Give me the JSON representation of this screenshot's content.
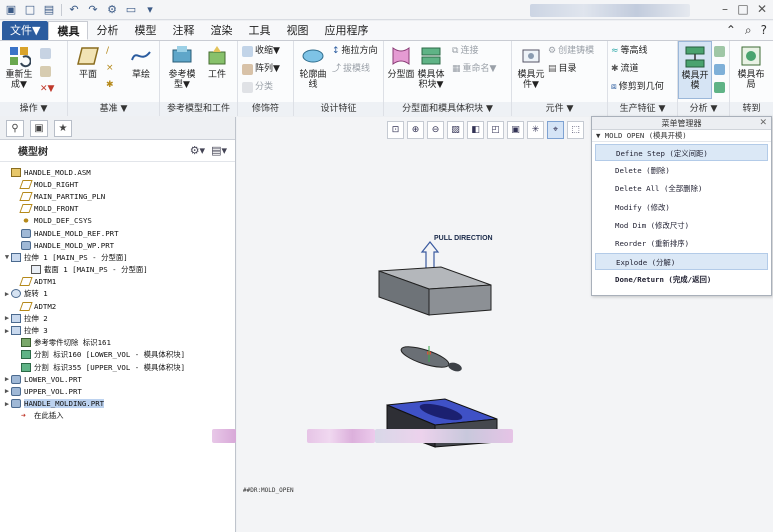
{
  "titlebar": {
    "quick_access_icons": [
      "new-icon",
      "open-icon",
      "save-icon",
      "undo-icon",
      "redo-icon",
      "regenerate-icon",
      "windows-icon",
      "close-icon"
    ],
    "window_controls": [
      "minimize",
      "maximize",
      "close"
    ]
  },
  "menu": {
    "tabs": [
      "文件▼",
      "模具",
      "分析",
      "模型",
      "注释",
      "渲染",
      "工具",
      "视图",
      "应用程序"
    ],
    "active_tab": "模具",
    "right_icons": [
      "ribbon-toggle-icon",
      "search-icon",
      "help-icon"
    ]
  },
  "ribbon": {
    "groups": [
      {
        "label": "操作 ▼",
        "big": [
          "重新生成▼"
        ],
        "small": [
          "✕▼"
        ]
      },
      {
        "label": "基准 ▼",
        "big": [
          "平面",
          "草绘"
        ],
        "small": []
      },
      {
        "label": "参考模型和工件",
        "big": [
          "参考模型▼",
          "工件"
        ],
        "small": []
      },
      {
        "label": "修饰符",
        "big": [],
        "small": [
          "收缩▼",
          "阵列▼",
          "分类"
        ]
      },
      {
        "label": "设计特征",
        "big": [
          "轮廓曲线"
        ],
        "small": [
          "拖拉方向",
          "拔模线"
        ]
      },
      {
        "label": "分型面和模具体积块 ▼",
        "big": [
          "分型面",
          "模具体积块▼"
        ],
        "small": [
          "连接",
          "重命名▼"
        ]
      },
      {
        "label": "元件 ▼",
        "big": [
          "模具元件▼"
        ],
        "small": [
          "创建铸模",
          "目录"
        ]
      },
      {
        "label": "生产特征 ▼",
        "big": [],
        "small": [
          "等高线",
          "流道",
          "修剪到几何"
        ]
      },
      {
        "label": "分析 ▼",
        "big": [
          "模具开模"
        ],
        "small": []
      },
      {
        "label": "转到",
        "big": [
          "模具布局"
        ],
        "small": []
      }
    ]
  },
  "left_panel": {
    "heading": "模型树",
    "tree": [
      {
        "label": "HANDLE_MOLD.ASM",
        "icon": "assembly-icon",
        "expander": "",
        "indent": 0
      },
      {
        "label": "MOLD_RIGHT",
        "icon": "datum-plane-icon",
        "expander": "",
        "indent": 1
      },
      {
        "label": "MAIN_PARTING_PLN",
        "icon": "datum-plane-icon",
        "expander": "",
        "indent": 1
      },
      {
        "label": "MOLD_FRONT",
        "icon": "datum-plane-icon",
        "expander": "",
        "indent": 1
      },
      {
        "label": "MOLD_DEF_CSYS",
        "icon": "csys-icon",
        "expander": "",
        "indent": 1
      },
      {
        "label": "HANDLE_MOLD_REF.PRT",
        "icon": "part-icon",
        "expander": "",
        "indent": 1
      },
      {
        "label": "HANDLE_MOLD_WP.PRT",
        "icon": "part-icon",
        "expander": "",
        "indent": 1
      },
      {
        "label": "拉伸 1 [MAIN_PS - 分型面]",
        "icon": "extrude-icon",
        "expander": "▼",
        "indent": 0
      },
      {
        "label": "截面 1 [MAIN_PS - 分型面]",
        "icon": "sketch-icon",
        "expander": "",
        "indent": 2
      },
      {
        "label": "ADTM1",
        "icon": "datum-plane-icon",
        "expander": "",
        "indent": 1
      },
      {
        "label": "旋转 1",
        "icon": "revolve-icon",
        "expander": "▶",
        "indent": 0
      },
      {
        "label": "ADTM2",
        "icon": "datum-plane-icon",
        "expander": "",
        "indent": 1
      },
      {
        "label": "拉伸 2",
        "icon": "extrude-icon",
        "expander": "▶",
        "indent": 0
      },
      {
        "label": "拉伸 3",
        "icon": "extrude-icon",
        "expander": "▶",
        "indent": 0
      },
      {
        "label": "参考零件切除 标识161",
        "icon": "cut-icon",
        "expander": "",
        "indent": 1
      },
      {
        "label": "分割 标识160 [LOWER_VOL - 模具体积块]",
        "icon": "split-icon",
        "expander": "",
        "indent": 1
      },
      {
        "label": "分割 标识355 [UPPER_VOL - 模具体积块]",
        "icon": "split-icon",
        "expander": "",
        "indent": 1
      },
      {
        "label": "LOWER_VOL.PRT",
        "icon": "part-icon",
        "expander": "▶",
        "indent": 0
      },
      {
        "label": "UPPER_VOL.PRT",
        "icon": "part-icon",
        "expander": "▶",
        "indent": 0
      },
      {
        "label": "HANDLE_MOLDING.PRT",
        "icon": "part-icon",
        "expander": "▶",
        "indent": 0,
        "selected": true
      },
      {
        "label": "在此插入",
        "icon": "insert-arrow-icon",
        "expander": "",
        "indent": 1
      }
    ]
  },
  "graphics": {
    "annotation": "PULL DIRECTION",
    "status": "##DR:MOLD_OPEN"
  },
  "menu_manager": {
    "title": "菜单管理器",
    "subtitle": "▼ MOLD OPEN (模具开模)",
    "items": [
      {
        "label": "Define Step (定义间距)",
        "highlight": true,
        "bold": false
      },
      {
        "label": "Delete (删除)",
        "highlight": false,
        "bold": false
      },
      {
        "label": "Delete All (全部删除)",
        "highlight": false,
        "bold": false
      },
      {
        "label": "Modify (修改)",
        "highlight": false,
        "bold": false
      },
      {
        "label": "Mod Dim (修改尺寸)",
        "highlight": false,
        "bold": false
      },
      {
        "label": "Reorder (重新排序)",
        "highlight": false,
        "bold": false
      },
      {
        "label": "Explode (分解)",
        "highlight": true,
        "bold": false
      },
      {
        "label": "Done/Return (完成/返回)",
        "highlight": false,
        "bold": true
      }
    ]
  },
  "colors": {
    "accent": "#2b5c9f",
    "selection": "#bcd2ef",
    "highlight": "#dbe8f6"
  }
}
